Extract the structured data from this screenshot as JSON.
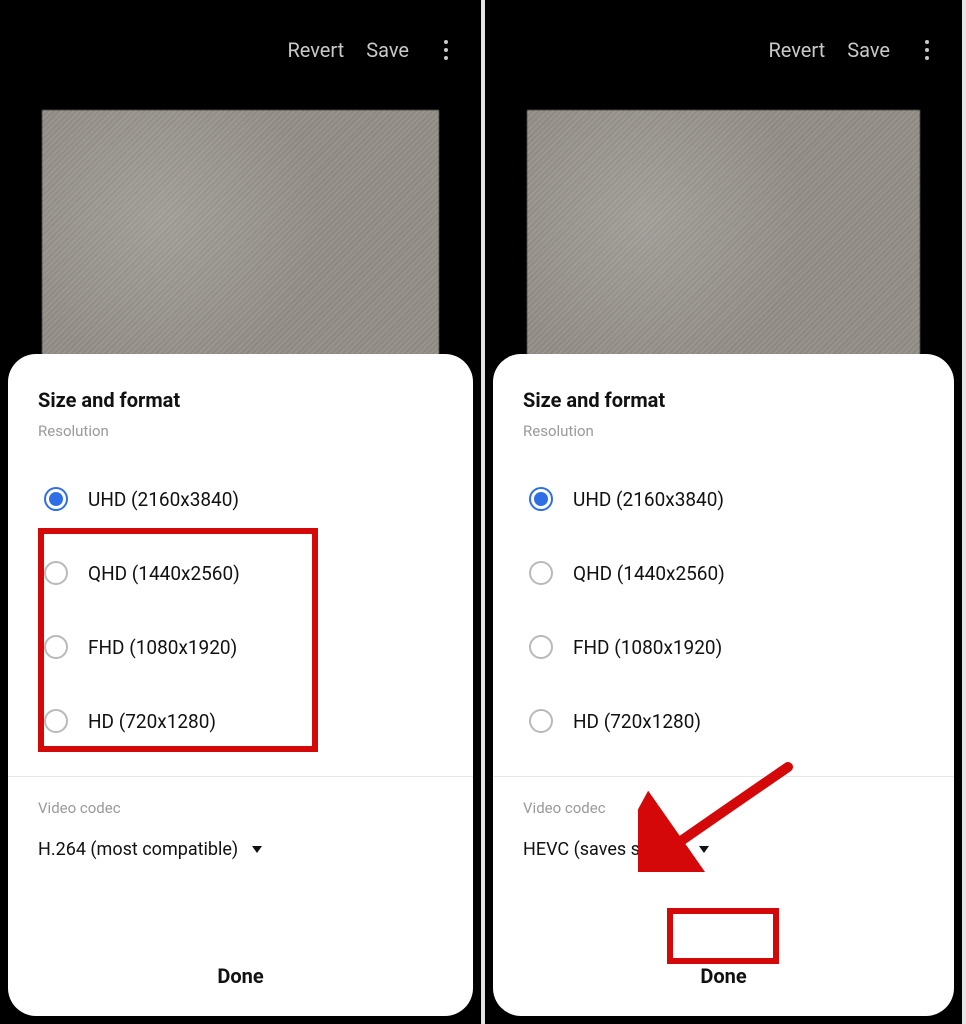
{
  "topbar": {
    "revert": "Revert",
    "save": "Save"
  },
  "sheet": {
    "title": "Size and format",
    "resolution_label": "Resolution",
    "codec_label": "Video codec",
    "done": "Done"
  },
  "resolutions": [
    {
      "label": "UHD (2160x3840)",
      "selected": true
    },
    {
      "label": "QHD (1440x2560)",
      "selected": false
    },
    {
      "label": "FHD (1080x1920)",
      "selected": false
    },
    {
      "label": "HD (720x1280)",
      "selected": false
    }
  ],
  "left": {
    "codec_value": "H.264 (most compatible)"
  },
  "right": {
    "codec_value": "HEVC (saves space)"
  }
}
